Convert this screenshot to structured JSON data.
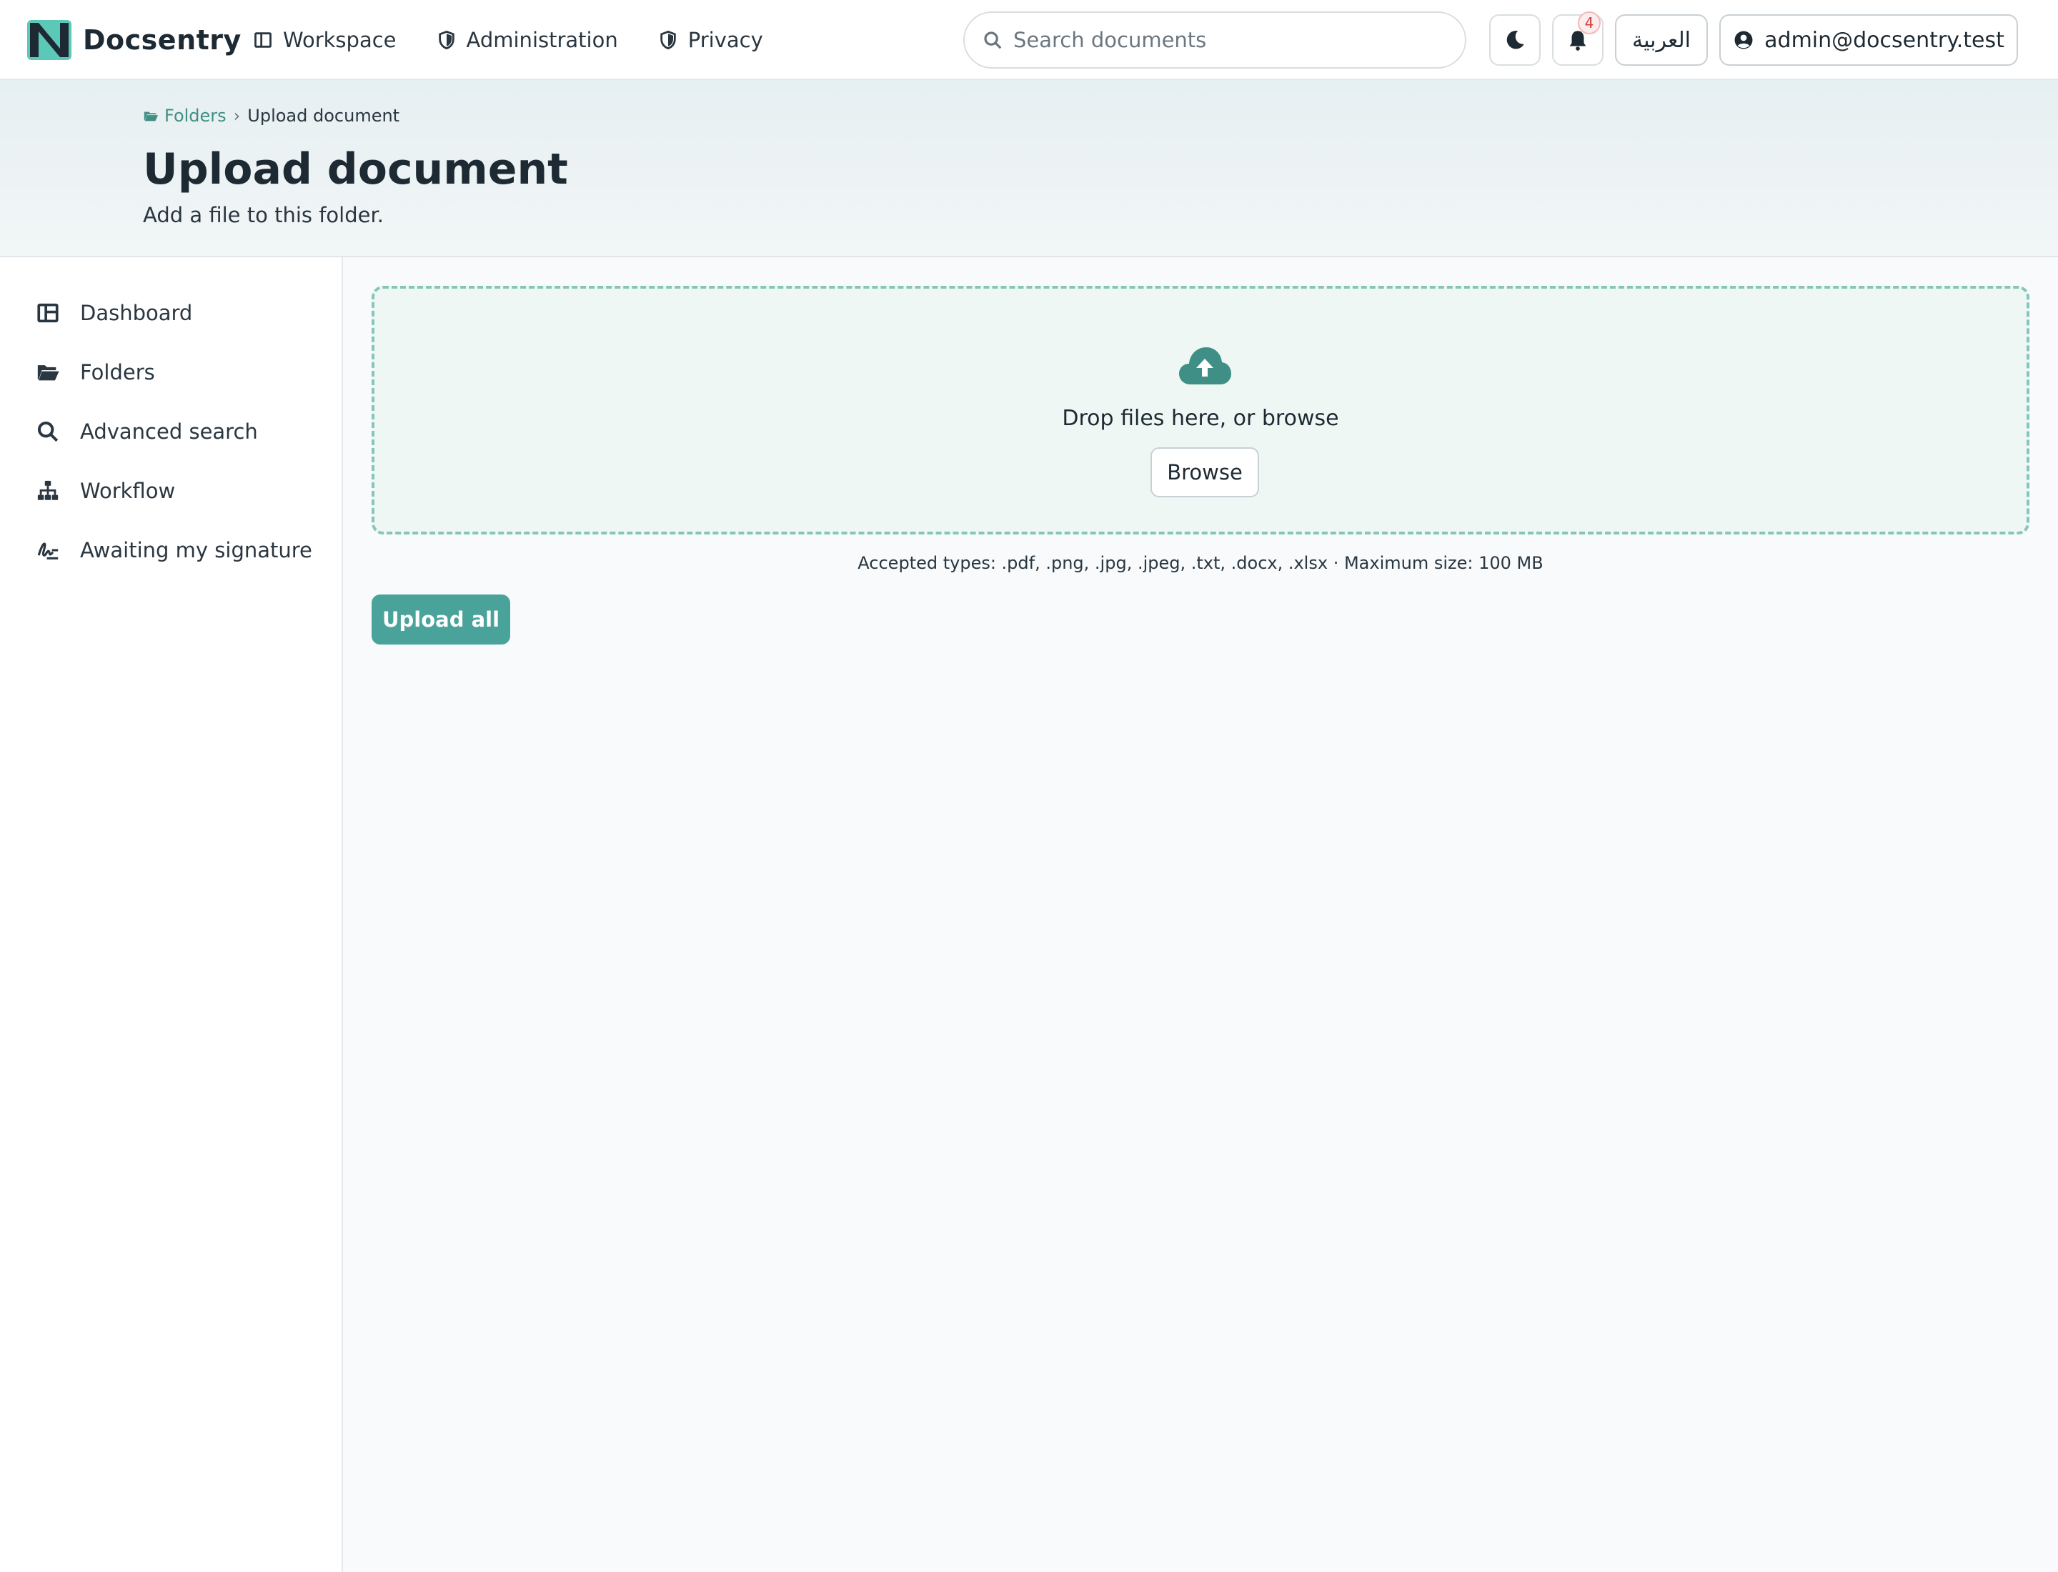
{
  "app": {
    "name": "Docsentry"
  },
  "topnav": {
    "links": [
      {
        "label": "Workspace",
        "icon": "columns-icon"
      },
      {
        "label": "Administration",
        "icon": "shield-icon"
      },
      {
        "label": "Privacy",
        "icon": "shield-icon"
      }
    ],
    "search": {
      "placeholder": "Search documents",
      "value": ""
    },
    "theme_toggle_icon": "moon-icon",
    "notifications": {
      "icon": "bell-icon",
      "count": "4"
    },
    "language_label": "العربية",
    "user": {
      "email": "admin@docsentry.test",
      "icon": "user-circle-icon"
    }
  },
  "header": {
    "breadcrumb": {
      "parent": "Folders",
      "separator": "›",
      "current": "Upload document"
    },
    "title": "Upload document",
    "subtitle": "Add a file to this folder."
  },
  "sidebar": {
    "items": [
      {
        "label": "Dashboard",
        "icon": "dashboard-icon"
      },
      {
        "label": "Folders",
        "icon": "folder-icon"
      },
      {
        "label": "Advanced search",
        "icon": "search-icon"
      },
      {
        "label": "Workflow",
        "icon": "sitemap-icon"
      },
      {
        "label": "Awaiting my signature",
        "icon": "signature-icon"
      }
    ]
  },
  "upload": {
    "drop_text": "Drop files here, or browse",
    "browse_label": "Browse",
    "accepted_text": "Accepted types: .pdf, .png, .jpg, .jpeg, .txt, .docx, .xlsx · Maximum size: 100 MB",
    "upload_all_label": "Upload all"
  },
  "colors": {
    "accent": "#4aa39a",
    "dropzone_border": "#86c6b8",
    "dropzone_bg": "#eef7f4",
    "badge": "#d23b3b"
  }
}
